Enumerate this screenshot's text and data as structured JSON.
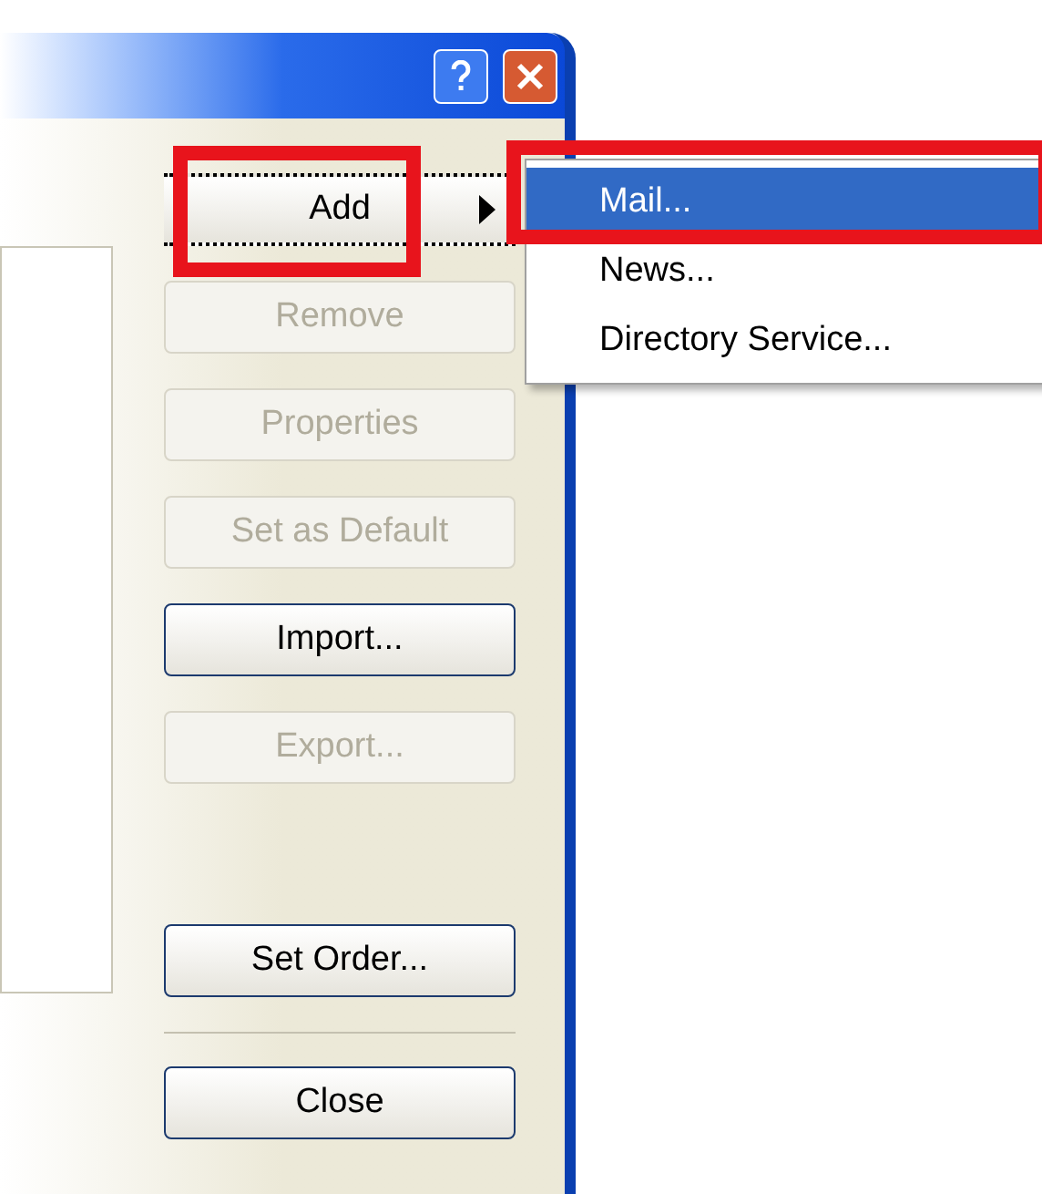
{
  "buttons": [
    {
      "label": "Add",
      "disabled": false,
      "focused": true,
      "submenu": true
    },
    {
      "label": "Remove",
      "disabled": true,
      "focused": false,
      "submenu": false
    },
    {
      "label": "Properties",
      "disabled": true,
      "focused": false,
      "submenu": false
    },
    {
      "label": "Set as Default",
      "disabled": true,
      "focused": false,
      "submenu": false
    },
    {
      "label": "Import...",
      "disabled": false,
      "focused": false,
      "submenu": false
    },
    {
      "label": "Export...",
      "disabled": true,
      "focused": false,
      "submenu": false
    },
    {
      "label": "Set Order...",
      "disabled": false,
      "focused": false,
      "submenu": false
    }
  ],
  "close_button": {
    "label": "Close"
  },
  "add_menu": [
    {
      "label": "Mail...",
      "selected": true
    },
    {
      "label": "News...",
      "selected": false
    },
    {
      "label": "Directory Service...",
      "selected": false
    }
  ]
}
